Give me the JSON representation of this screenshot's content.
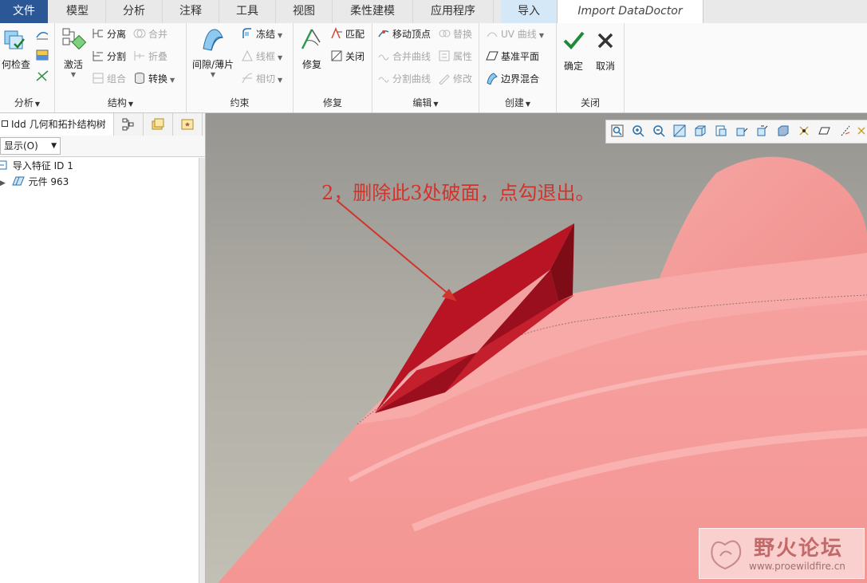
{
  "tabs": {
    "file": "文件",
    "model": "模型",
    "analysis": "分析",
    "annotate": "注释",
    "tools": "工具",
    "view": "视图",
    "flexible": "柔性建模",
    "apps": "应用程序",
    "import": "导入",
    "doctor": "Import DataDoctor"
  },
  "ribbon": {
    "analysis": {
      "check": "何检查",
      "label": "分析"
    },
    "structure": {
      "activate": "激活",
      "separate": "分离",
      "split": "分割",
      "group": "组合",
      "merge": "合并",
      "fold": "折叠",
      "convert": "转换",
      "label": "结构"
    },
    "constraint": {
      "gap": "间隙/薄片",
      "freeze": "冻结",
      "wireframe": "线框",
      "tangent": "相切",
      "label": "约束"
    },
    "repair": {
      "repair": "修复",
      "match": "匹配",
      "close": "关闭",
      "label": "修复"
    },
    "edit": {
      "move_vertex": "移动顶点",
      "replace": "替换",
      "merge_curve": "合并曲线",
      "property": "属性",
      "split_curve": "分割曲线",
      "modify": "修改",
      "label": "编辑"
    },
    "create": {
      "uv_curve": "UV 曲线",
      "datum_plane": "基准平面",
      "boundary_blend": "边界混合",
      "label": "创建"
    },
    "close": {
      "ok": "确定",
      "cancel": "取消",
      "label": "关闭"
    }
  },
  "panel": {
    "tab_title": "Idd 几何和拓扑结构树",
    "show": "显示(O)",
    "tree": [
      {
        "label": "导入特征 ID 1"
      },
      {
        "label": "元件 963"
      }
    ]
  },
  "viewport": {
    "annotation": "2，删除此3处破面，点勾退出。",
    "watermark_title": "野火论坛",
    "watermark_url": "www.proewildfire.cn"
  },
  "colors": {
    "file_tab": "#2b5797",
    "model_surface": "#f59a99",
    "annotation": "#d0342c",
    "broken_face": "#a8101e"
  }
}
